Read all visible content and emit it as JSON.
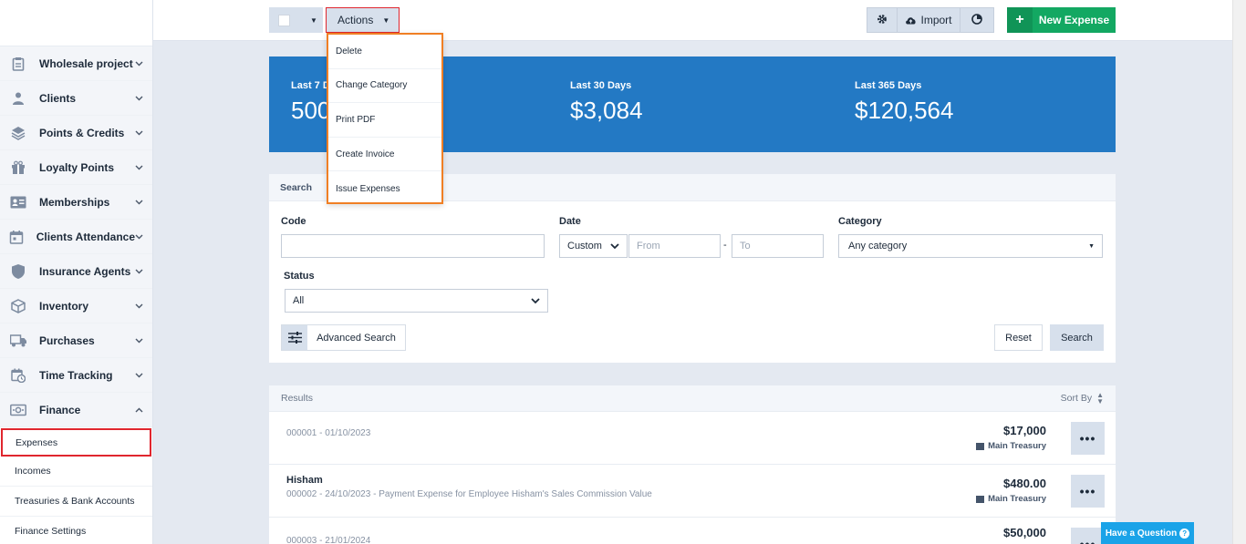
{
  "sidebar": {
    "items": [
      {
        "label": "Wholesale project",
        "icon": "clipboard-icon"
      },
      {
        "label": "Clients",
        "icon": "user-icon"
      },
      {
        "label": "Points & Credits",
        "icon": "layers-icon"
      },
      {
        "label": "Loyalty Points",
        "icon": "gift-icon"
      },
      {
        "label": "Memberships",
        "icon": "id-card-icon"
      },
      {
        "label": "Clients Attendance",
        "icon": "calendar-icon"
      },
      {
        "label": "Insurance Agents",
        "icon": "shield-icon"
      },
      {
        "label": "Inventory",
        "icon": "box-icon"
      },
      {
        "label": "Purchases",
        "icon": "truck-icon"
      },
      {
        "label": "Time Tracking",
        "icon": "calendar-clock-icon"
      },
      {
        "label": "Finance",
        "icon": "money-icon"
      }
    ],
    "finance_sub": [
      "Expenses",
      "Incomes",
      "Treasuries & Bank Accounts",
      "Finance Settings"
    ]
  },
  "toolbar": {
    "actions_label": "Actions",
    "import_label": "Import",
    "new_expense_label": "New Expense"
  },
  "actions_menu": [
    "Delete",
    "Change Category",
    "Print PDF",
    "Create Invoice",
    "Issue Expenses"
  ],
  "stats": [
    {
      "label": "Last 7 Days",
      "value": "500"
    },
    {
      "label": "Last 30 Days",
      "value": "$3,084"
    },
    {
      "label": "Last 365 Days",
      "value": "$120,564"
    }
  ],
  "search": {
    "tab_label": "Search",
    "code_label": "Code",
    "date_label": "Date",
    "date_mode": "Custom",
    "from_placeholder": "From",
    "to_placeholder": "To",
    "category_label": "Category",
    "category_value": "Any category",
    "status_label": "Status",
    "status_value": "All",
    "advanced_label": "Advanced Search",
    "reset_label": "Reset",
    "search_label": "Search"
  },
  "results": {
    "label": "Results",
    "sort_label": "Sort By",
    "rows": [
      {
        "name": "",
        "desc": "000001 - 01/10/2023",
        "amount": "$17,000",
        "treasury": "Main Treasury"
      },
      {
        "name": "Hisham",
        "desc": "000002 - 24/10/2023 - Payment Expense for Employee Hisham's Sales Commission Value",
        "amount": "$480.00",
        "treasury": "Main Treasury"
      },
      {
        "name": "",
        "desc": "000003 - 21/01/2024",
        "amount": "$50,000",
        "treasury": ""
      }
    ]
  },
  "help": {
    "label": "Have a Question"
  }
}
